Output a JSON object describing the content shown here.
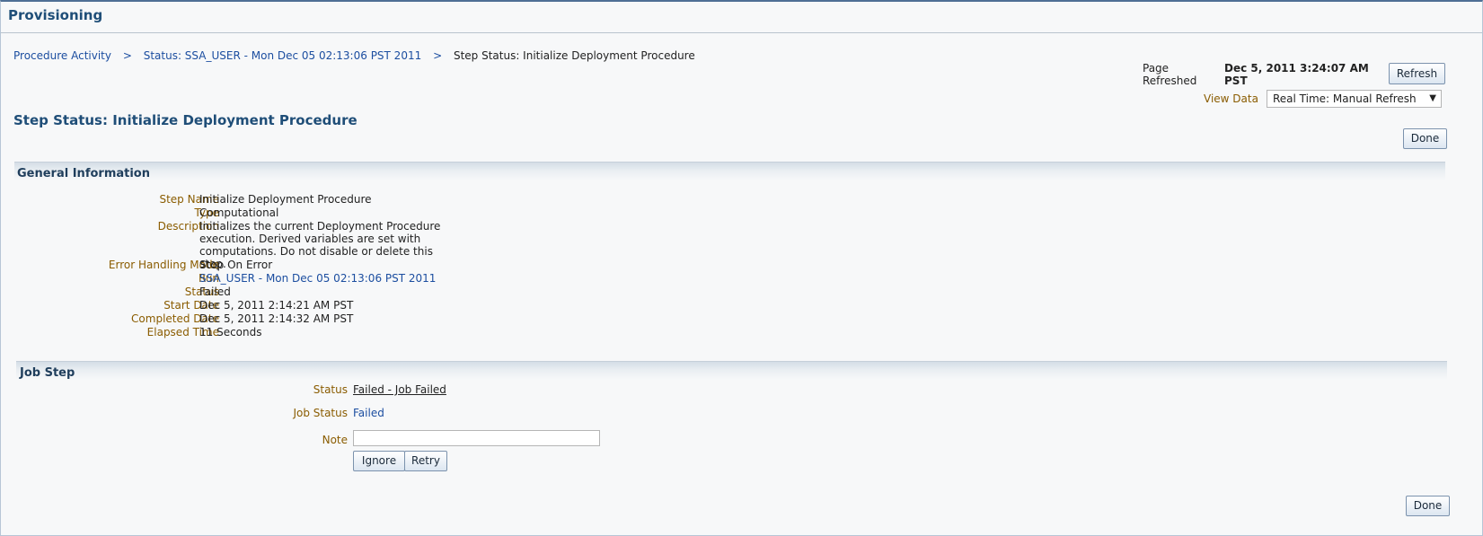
{
  "app": {
    "title": "Provisioning"
  },
  "breadcrumb": {
    "items": [
      "Procedure Activity",
      "Status: SSA_USER - Mon Dec 05 02:13:06 PST 2011",
      "Step Status: Initialize Deployment Procedure"
    ],
    "separator": ">"
  },
  "refresh": {
    "page_refreshed_label_line1": "Page",
    "page_refreshed_label_line2": "Refreshed",
    "refreshed_value_line1": "Dec 5, 2011 3:24:07 AM",
    "refreshed_value_line2": "PST",
    "refresh_button": "Refresh",
    "view_data_label": "View Data",
    "view_data_value": "Real Time: Manual Refresh"
  },
  "page": {
    "title": "Step Status: Initialize Deployment Procedure",
    "done_label": "Done"
  },
  "general": {
    "title": "General Information",
    "fields": {
      "step_name": {
        "label": "Step Name",
        "value": "Initialize Deployment Procedure"
      },
      "type": {
        "label": "Type",
        "value": "Computational"
      },
      "description": {
        "label": "Description",
        "value": "Initializes the current Deployment Procedure execution. Derived variables are set with computations. Do not disable or delete this step."
      },
      "error_mode": {
        "label": "Error Handling Mode",
        "value": "Stop On Error"
      },
      "run": {
        "label": "Run",
        "value": "SSA_USER - Mon Dec 05 02:13:06 PST 2011"
      },
      "status": {
        "label": "Status",
        "value": "Failed"
      },
      "start_date": {
        "label": "Start Date",
        "value": "Dec 5, 2011 2:14:21 AM PST"
      },
      "completed_date": {
        "label": "Completed Date",
        "value": "Dec 5, 2011 2:14:32 AM PST"
      },
      "elapsed": {
        "label": "Elapsed Time",
        "value": "11 Seconds"
      }
    }
  },
  "job_step": {
    "title": "Job Step",
    "status_label": "Status",
    "status_value": "Failed - Job Failed",
    "job_status_label": "Job Status",
    "job_status_value": "Failed",
    "note_label": "Note",
    "note_value": "",
    "ignore_button": "Ignore",
    "retry_button": "Retry"
  },
  "colors": {
    "link": "#1c4ea0",
    "label": "#8a5c00",
    "title": "#1f4e78"
  }
}
